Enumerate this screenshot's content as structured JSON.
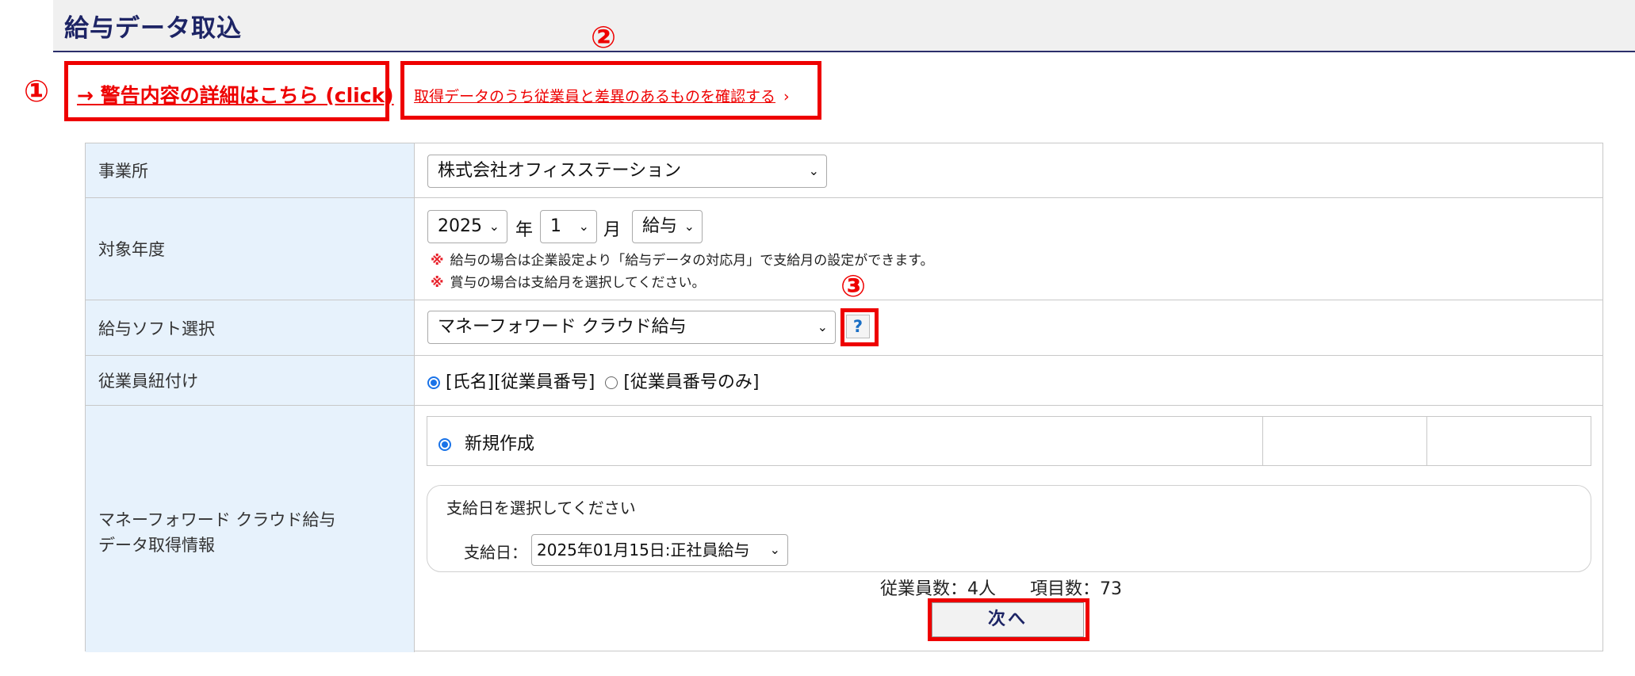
{
  "page": {
    "title": "給与データ取込"
  },
  "annotations": {
    "m1": "①",
    "m2": "②",
    "m3": "③"
  },
  "links": {
    "warning_detail": "→ 警告内容の詳細はこちら (click)",
    "diff_check": "取得データのうち従業員と差異のあるものを確認する",
    "diff_chevron": "›"
  },
  "form": {
    "office": {
      "label": "事業所",
      "value": "株式会社オフィスステーション"
    },
    "target_year": {
      "label": "対象年度",
      "year": "2025",
      "year_unit": "年",
      "month": "1",
      "month_unit": "月",
      "type": "給与",
      "note_mark": "※",
      "notes": [
        "給与の場合は企業設定より「給与データの対応月」で支給月の設定ができます。",
        "賞与の場合は支給月を選択してください。"
      ]
    },
    "payroll_software": {
      "label": "給与ソフト選択",
      "value": "マネーフォワード クラウド給与",
      "help": "?"
    },
    "employee_link": {
      "label": "従業員紐付け",
      "options": [
        {
          "text": "[氏名][従業員番号]",
          "checked": true
        },
        {
          "text": "[従業員番号のみ]",
          "checked": false
        }
      ]
    },
    "fetch_info": {
      "label_line1": "マネーフォワード クラウド給与",
      "label_line2": "データ取得情報",
      "mode": {
        "text": "新規作成",
        "checked": true
      },
      "paydate_prompt": "支給日を選択してください",
      "paydate_label": "支給日：",
      "paydate_value": "2025年01月15日:正社員給与",
      "employee_count": "従業員数：4人",
      "item_count": "項目数：73"
    }
  },
  "buttons": {
    "next": "次へ"
  },
  "icons": {
    "chevron_down": "chevron-down-icon",
    "help": "question-icon",
    "arrow_right": "arrow-right-icon"
  },
  "colors": {
    "accent_red": "#ee0000",
    "title_navy": "#1d2465",
    "label_bg": "#e7f2fc",
    "radio_blue": "#1a73e8"
  }
}
